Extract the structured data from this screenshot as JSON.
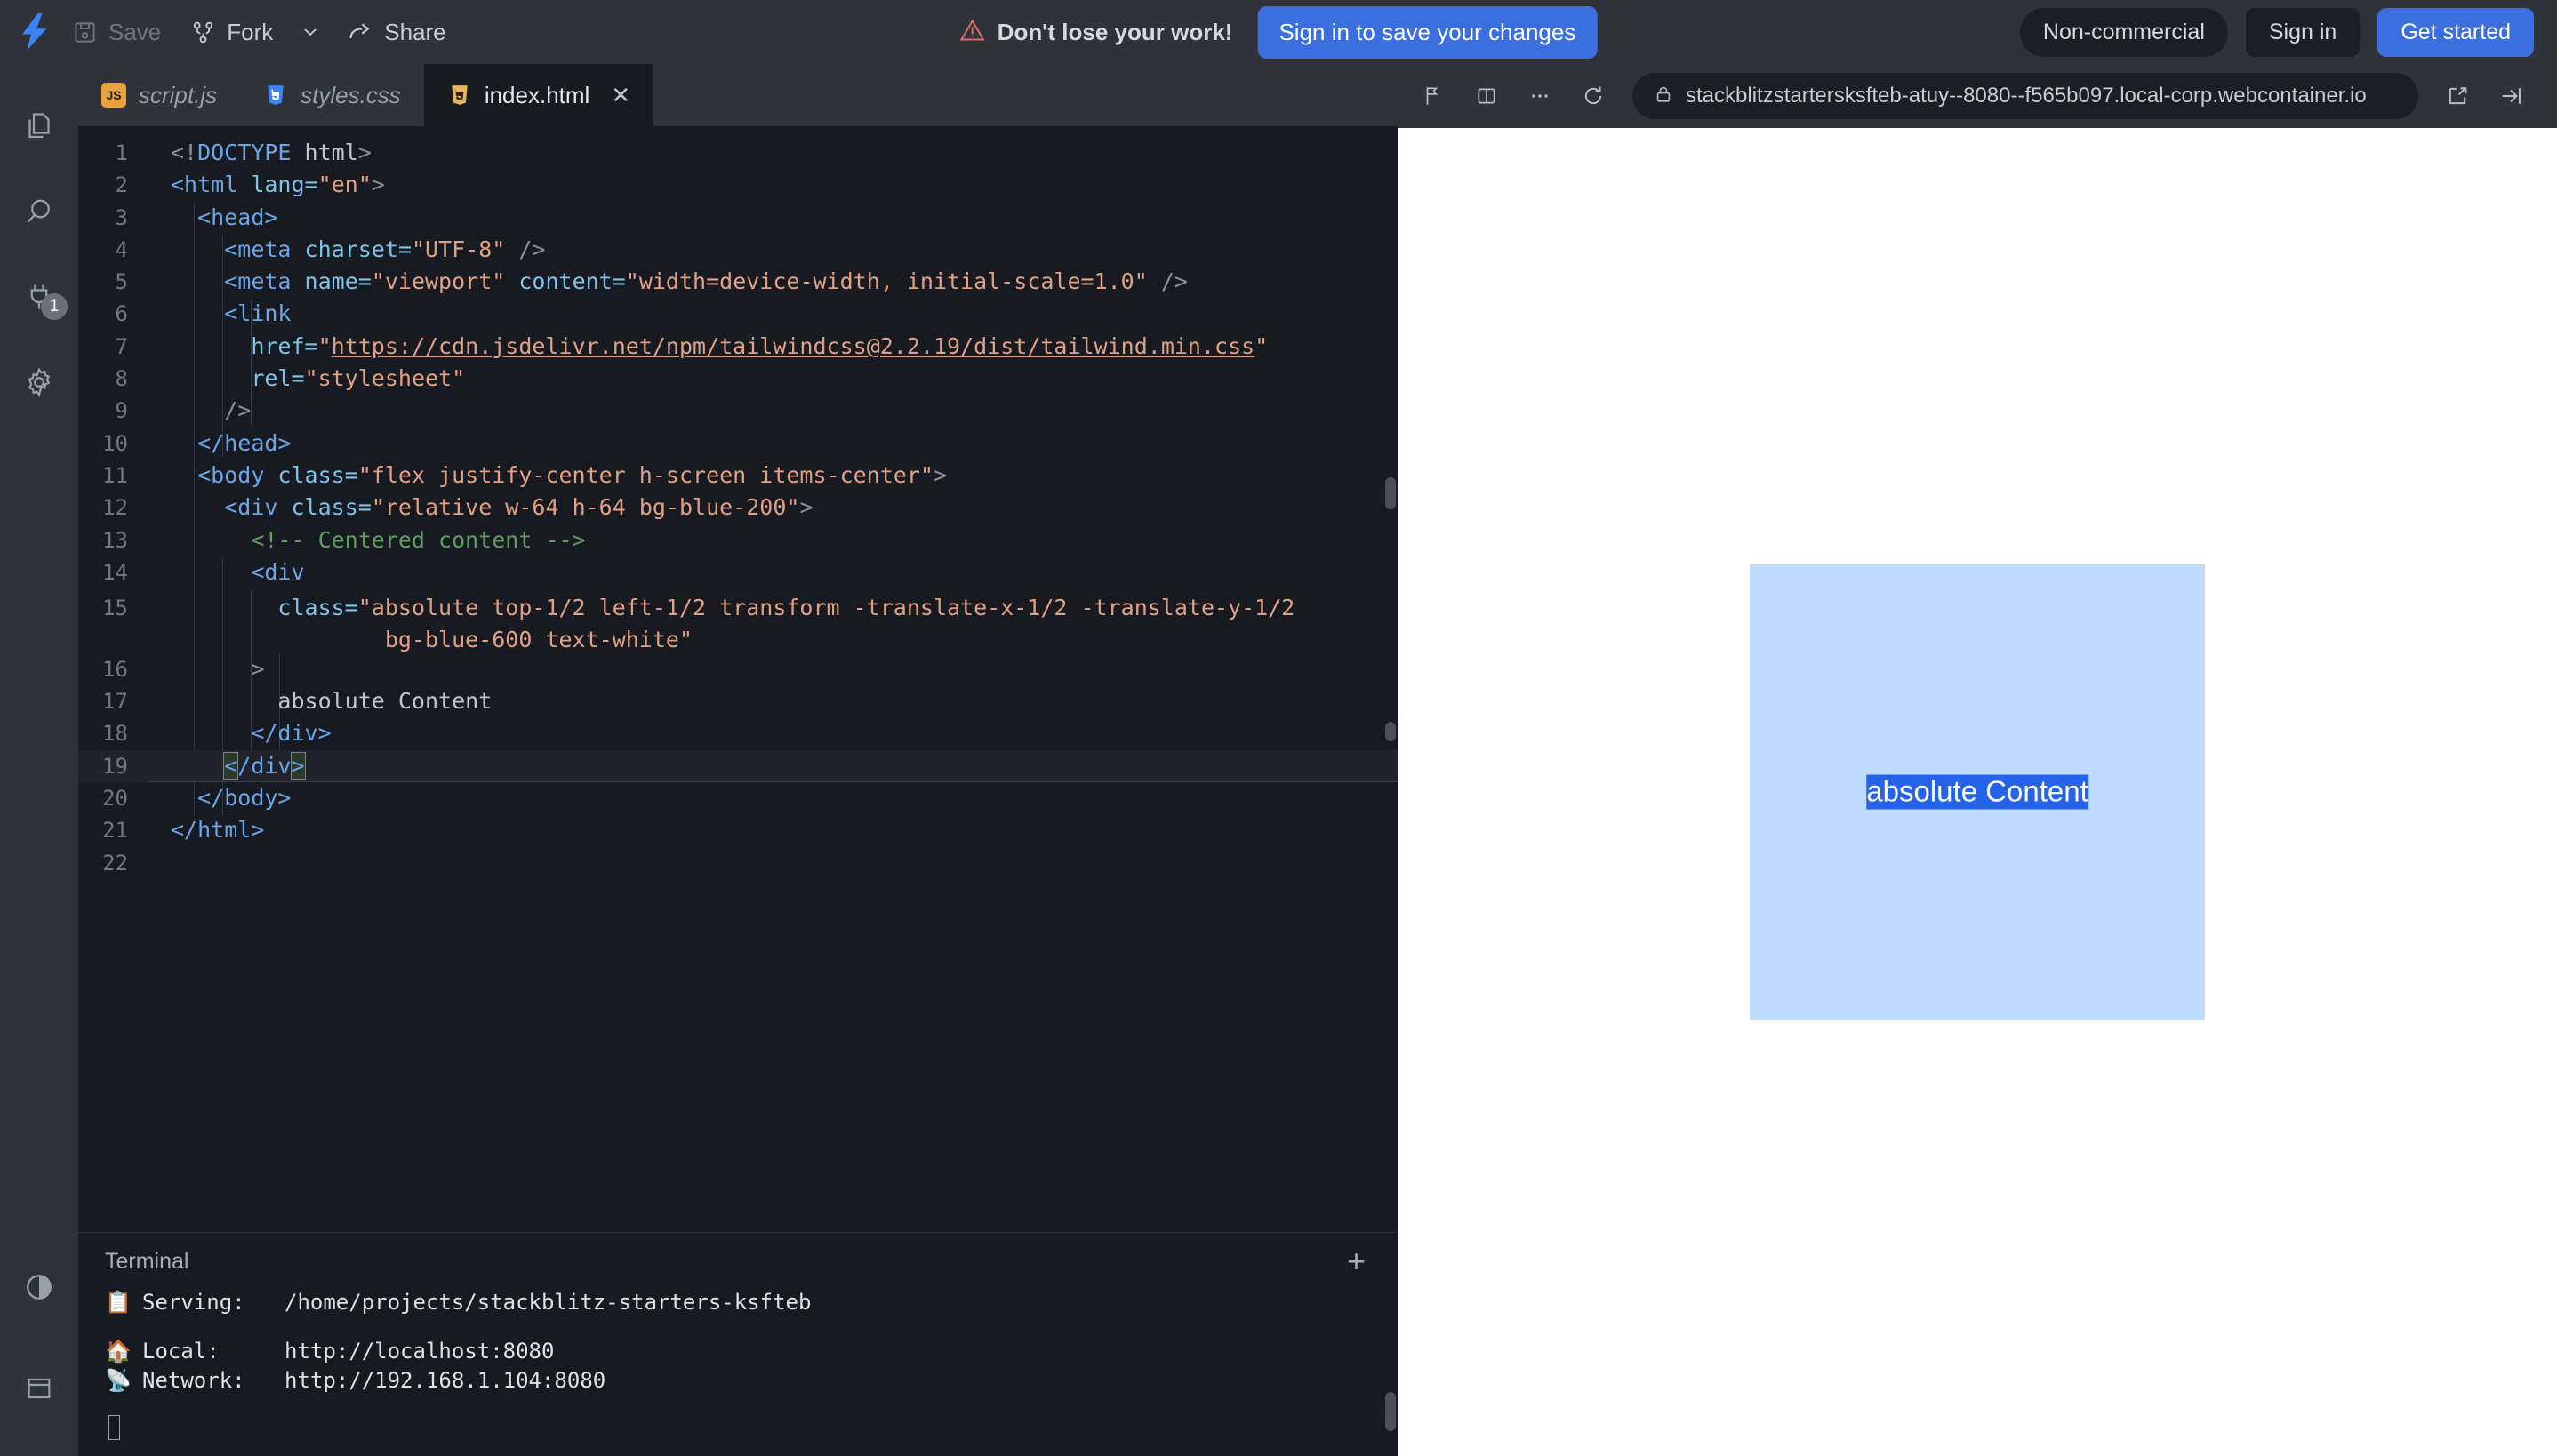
{
  "header": {
    "logo": "stackblitz-bolt-logo",
    "save_label": "Save",
    "fork_label": "Fork",
    "share_label": "Share",
    "warning_text": "Don't lose your work!",
    "signin_save_label": "Sign in to save your changes",
    "noncommercial_label": "Non-commercial",
    "signin_label": "Sign in",
    "getstarted_label": "Get started",
    "accent_blue": "#3b6fe0",
    "warning_red": "#e06c6c"
  },
  "activity_bar": {
    "items": [
      {
        "name": "files-icon",
        "badge": ""
      },
      {
        "name": "search-icon",
        "badge": ""
      },
      {
        "name": "plug-icon",
        "badge": "1"
      },
      {
        "name": "gear-icon",
        "badge": ""
      }
    ],
    "bottom": [
      {
        "name": "theme-toggle-icon"
      },
      {
        "name": "layout-panel-icon"
      }
    ]
  },
  "tabs": [
    {
      "label": "script.js",
      "icon": "js-file-icon",
      "active": false,
      "closable": false
    },
    {
      "label": "styles.css",
      "icon": "css-file-icon",
      "active": false,
      "closable": false
    },
    {
      "label": "index.html",
      "icon": "html-file-icon",
      "active": true,
      "closable": true,
      "close_glyph": "✕"
    }
  ],
  "editor": {
    "active_line": 19,
    "lines": [
      {
        "n": "1"
      },
      {
        "n": "2"
      },
      {
        "n": "3"
      },
      {
        "n": "4"
      },
      {
        "n": "5"
      },
      {
        "n": "6"
      },
      {
        "n": "7"
      },
      {
        "n": "8"
      },
      {
        "n": "9"
      },
      {
        "n": "10"
      },
      {
        "n": "11"
      },
      {
        "n": "12"
      },
      {
        "n": "13"
      },
      {
        "n": "14"
      },
      {
        "n": "15"
      },
      {
        "n": "16"
      },
      {
        "n": "17"
      },
      {
        "n": "18"
      },
      {
        "n": "19"
      },
      {
        "n": "20"
      },
      {
        "n": "21"
      },
      {
        "n": "22"
      }
    ],
    "code": {
      "l1": "<!DOCTYPE html>",
      "l2_tag": "<html",
      "l2_attr": " lang=",
      "l2_str": "\"en\"",
      "l2_end": ">",
      "l3": "<head>",
      "l4_tag": "<meta",
      "l4_attr": " charset=",
      "l4_str": "\"UTF-8\"",
      "l4_end": " />",
      "l5_tag": "<meta",
      "l5_attr1": " name=",
      "l5_str1": "\"viewport\"",
      "l5_attr2": " content=",
      "l5_str2": "\"width=device-width, initial-scale=1.0\"",
      "l5_end": " />",
      "l6": "<link",
      "l7_attr": "href=",
      "l7_str_open": "\"",
      "l7_url": "https://cdn.jsdelivr.net/npm/tailwindcss@2.2.19/dist/tailwind.min.css",
      "l7_str_close": "\"",
      "l8_attr": "rel=",
      "l8_str": "\"stylesheet\"",
      "l9": "/>",
      "l10": "</head>",
      "l11_tag": "<body",
      "l11_attr": " class=",
      "l11_str": "\"flex justify-center h-screen items-center\"",
      "l11_end": ">",
      "l12_tag": "<div",
      "l12_attr": " class=",
      "l12_str": "\"relative w-64 h-64 bg-blue-200\"",
      "l12_end": ">",
      "l13_comment": "<!-- Centered content -->",
      "l14": "<div",
      "l15_attr": "class=",
      "l15_str_a": "\"absolute top-1/2 left-1/2 transform -translate-x-1/2 -translate-y-1/2",
      "l15_str_b": "bg-blue-600 text-white\"",
      "l16": ">",
      "l17_text": "absolute Content",
      "l18": "</div>",
      "l19_a": "<",
      "l19_b": "/div",
      "l19_c": ">",
      "l20": "</body>",
      "l21": "</html>"
    }
  },
  "terminal": {
    "title": "Terminal",
    "add_glyph": "+",
    "rows": [
      {
        "icon": "📋",
        "key": "Serving:",
        "value": "/home/projects/stackblitz-starters-ksfteb"
      },
      {
        "icon": "🏠",
        "key": "Local:",
        "value": "http://localhost:8080"
      },
      {
        "icon": "📡",
        "key": "Network:",
        "value": "http://192.168.1.104:8080"
      }
    ]
  },
  "preview": {
    "toolbar_icons": [
      "inspect-icon",
      "split-view-icon",
      "more-options-icon",
      "reload-icon"
    ],
    "lock_icon": "lock-icon",
    "url": "stackblitzstartersksfteb-atuy--8080--f565b097.local-corp.webcontainer.io",
    "open-new-window-icon": "open-external-icon",
    "collapse-icon": "collapse-right-icon",
    "box_color": "#bfdbfe",
    "label_bg": "#2563eb",
    "label_text": "absolute Content"
  }
}
